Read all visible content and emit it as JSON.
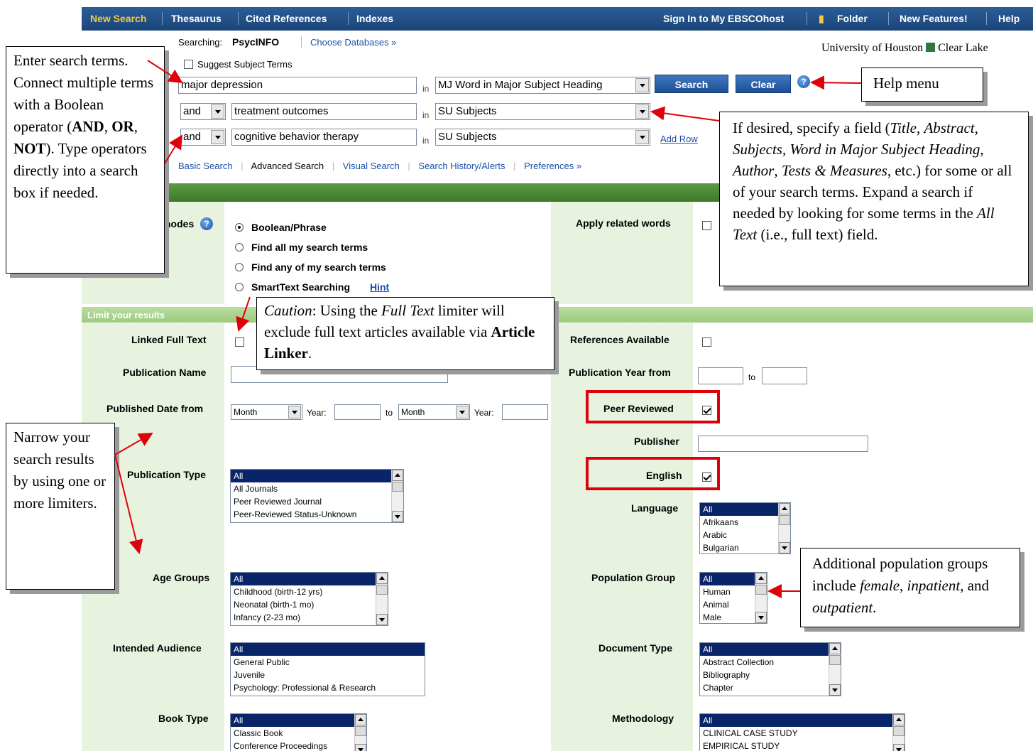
{
  "topbar": {
    "new_search": "New Search",
    "thesaurus": "Thesaurus",
    "cited_references": "Cited References",
    "indexes": "Indexes",
    "sign_in": "Sign In to My EBSCOhost",
    "folder": "Folder",
    "new_features": "New Features!",
    "help": "Help"
  },
  "search": {
    "searching_label": "Searching:",
    "database": "PsycINFO",
    "choose_databases": "Choose Databases »",
    "institution": "University of Houston",
    "institution_suffix": "Clear Lake",
    "suggest_subject_terms": "Suggest Subject Terms",
    "rows": [
      {
        "operator": "",
        "term": "major depression",
        "field": "MJ Word in Major Subject Heading"
      },
      {
        "operator": "and",
        "term": "treatment outcomes",
        "field": "SU Subjects"
      },
      {
        "operator": "and",
        "term": "cognitive behavior therapy",
        "field": "SU Subjects"
      }
    ],
    "in_label": "in",
    "search_button": "Search",
    "clear_button": "Clear",
    "add_row": "Add Row",
    "help_glyph": "?"
  },
  "subnav": {
    "basic": "Basic Search",
    "advanced": "Advanced Search",
    "visual": "Visual Search",
    "history": "Search History/Alerts",
    "preferences": "Preferences »"
  },
  "search_options": {
    "bar_label_fragment": "s",
    "modes_label_fragment": "nodes",
    "modes": [
      "Boolean/Phrase",
      "Find all my search terms",
      "Find any of my search terms",
      "SmartText Searching"
    ],
    "hint": "Hint",
    "apply_related_words": "Apply related words"
  },
  "limits": {
    "bar_label": "Limit your results",
    "linked_full_text": "Linked Full Text",
    "references_available": "References Available",
    "publication_name": "Publication Name",
    "publication_year_from": "Publication Year from",
    "to": "to",
    "published_date_from": "Published Date from",
    "month": "Month",
    "year": "Year:",
    "peer_reviewed": "Peer Reviewed",
    "publisher": "Publisher",
    "english": "English",
    "publication_type": "Publication Type",
    "publication_type_options": [
      "All",
      "All Journals",
      "Peer Reviewed Journal",
      "Peer-Reviewed Status-Unknown"
    ],
    "language": "Language",
    "language_options": [
      "All",
      "Afrikaans",
      "Arabic",
      "Bulgarian"
    ],
    "age_groups": "Age Groups",
    "age_groups_options": [
      "All",
      "Childhood (birth-12 yrs)",
      "Neonatal (birth-1 mo)",
      "Infancy (2-23 mo)"
    ],
    "population_group": "Population Group",
    "population_group_options": [
      "All",
      "Human",
      "Animal",
      "Male"
    ],
    "intended_audience": "Intended Audience",
    "intended_audience_options": [
      "All",
      "General Public",
      "Juvenile",
      "Psychology: Professional & Research"
    ],
    "document_type": "Document Type",
    "document_type_options": [
      "All",
      "Abstract Collection",
      "Bibliography",
      "Chapter"
    ],
    "book_type": "Book Type",
    "book_type_options": [
      "All",
      "Classic Book",
      "Conference Proceedings"
    ],
    "methodology": "Methodology",
    "methodology_options": [
      "All",
      "CLINICAL CASE STUDY",
      "EMPIRICAL STUDY"
    ]
  },
  "annotations": {
    "enter_terms": {
      "p1": "Enter search terms. Connect multiple terms with a Boolean operator (",
      "and": "AND",
      ", ": ", ",
      "or": "OR",
      "sep2": ", ",
      "not": "NOT",
      "p2": "). Type operators directly into a search box if needed."
    },
    "help_menu": "Help menu",
    "field": {
      "t1": "If desired, specify a field (",
      "title": "Title",
      ",1": ", ",
      "abstract": "Abstract",
      ",2": ", ",
      "subjects": "Subjects",
      ",3": ", ",
      "wimsh": "Word in Major Subject Heading",
      ",4": ", ",
      "author": "Author",
      ",5": ", ",
      "tests": "Tests & Measures",
      "t2": ", etc.) for some or all of your search terms. Expand a search if needed by looking for some terms in the ",
      "alltext": "All Text",
      "t3": " (i.e., full text) field."
    },
    "caution": {
      "caution": "Caution",
      "t1": ": Using the ",
      "fulltext": "Full Text",
      "t2": " limiter will exclude full text articles available via ",
      "linker": "Article Linker",
      "t3": "."
    },
    "narrow": "Narrow your search results by using one or more limiters.",
    "population": {
      "t1": "Additional population groups include ",
      "female": "female",
      "t2": ", ",
      "inpatient": "inpatient",
      "t3": ", and ",
      "outpatient": "outpatient",
      "t4": "."
    }
  }
}
